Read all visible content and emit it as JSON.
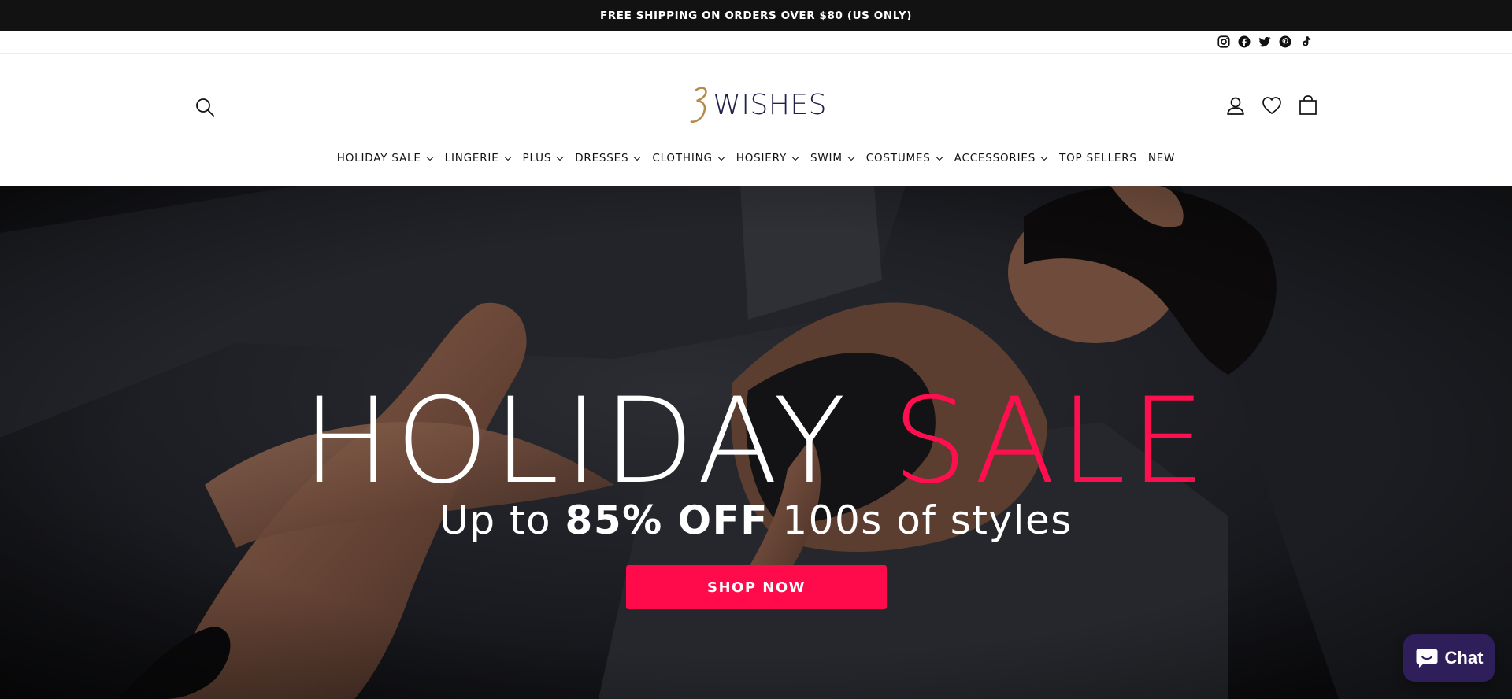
{
  "announcement": {
    "text": "FREE SHIPPING ON ORDERS OVER $80 (US ONLY)"
  },
  "social": {
    "icons": [
      "instagram-icon",
      "facebook-icon",
      "twitter-icon",
      "pinterest-icon",
      "tiktok-icon"
    ]
  },
  "header": {
    "logo_mark": "3",
    "logo_text": "WISHES",
    "icons": [
      "search-icon",
      "account-icon",
      "wishlist-heart-icon",
      "cart-bag-icon"
    ]
  },
  "nav": {
    "items": [
      {
        "label": "HOLIDAY SALE",
        "has_dropdown": true
      },
      {
        "label": "LINGERIE",
        "has_dropdown": true
      },
      {
        "label": "PLUS",
        "has_dropdown": true
      },
      {
        "label": "DRESSES",
        "has_dropdown": true
      },
      {
        "label": "CLOTHING",
        "has_dropdown": true
      },
      {
        "label": "HOSIERY",
        "has_dropdown": true
      },
      {
        "label": "SWIM",
        "has_dropdown": true
      },
      {
        "label": "COSTUMES",
        "has_dropdown": true
      },
      {
        "label": "ACCESSORIES",
        "has_dropdown": true
      },
      {
        "label": "TOP SELLERS",
        "has_dropdown": false
      },
      {
        "label": "NEW",
        "has_dropdown": false
      }
    ]
  },
  "hero": {
    "title_part1": "HOLIDAY ",
    "title_part2": "SALE",
    "sub_part1": "Up to ",
    "sub_bold": "85% OFF",
    "sub_part2": " 100s of styles",
    "cta": "SHOP NOW",
    "accent_color": "#ff0a4b"
  },
  "chat": {
    "label": "Chat",
    "color": "#2e1f5a"
  }
}
